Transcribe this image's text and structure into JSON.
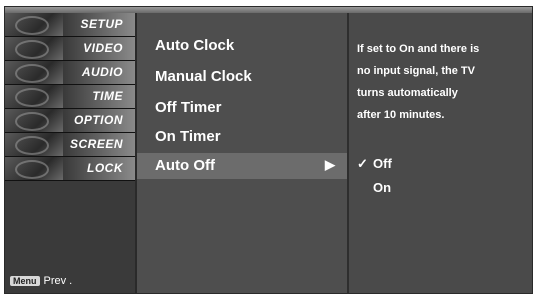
{
  "categories": [
    {
      "label": "SETUP"
    },
    {
      "label": "VIDEO"
    },
    {
      "label": "AUDIO"
    },
    {
      "label": "TIME"
    },
    {
      "label": "OPTION"
    },
    {
      "label": "SCREEN"
    },
    {
      "label": "LOCK"
    }
  ],
  "footer": {
    "menu_key": "Menu",
    "prev_label": "Prev ."
  },
  "submenu": [
    {
      "label": "Auto Clock"
    },
    {
      "label": "Manual Clock"
    },
    {
      "label": "Off Timer"
    },
    {
      "label": "On Timer"
    },
    {
      "label": "Auto Off",
      "arrow": "▶"
    }
  ],
  "info": {
    "lines": [
      "If set to On and there is",
      "no input signal, the TV",
      "turns automatically",
      "after 10 minutes."
    ]
  },
  "options": [
    {
      "check": "✓",
      "label": "Off"
    },
    {
      "check": "",
      "label": "On"
    }
  ]
}
